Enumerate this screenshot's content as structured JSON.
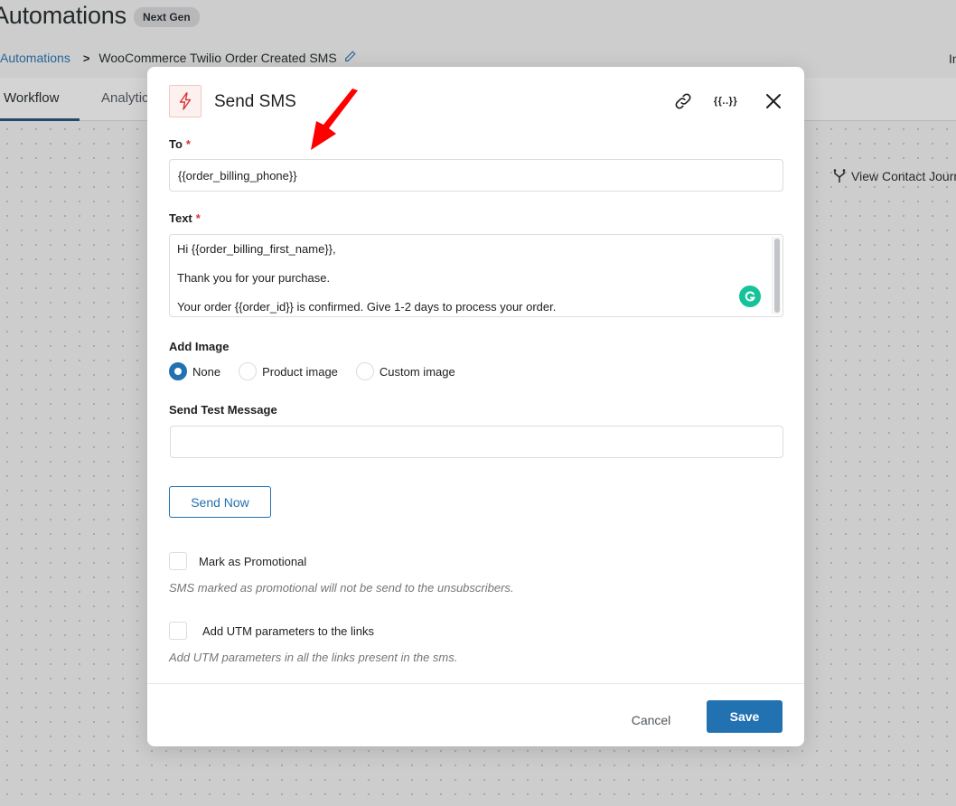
{
  "page": {
    "title": "Automations",
    "badge": "Next Gen",
    "breadcrumb": {
      "parent": "Automations",
      "separator": ">",
      "current": "WooCommerce Twilio Order Created SMS"
    },
    "top_right_text": "In",
    "tabs": [
      {
        "label": "Workflow",
        "active": true
      },
      {
        "label": "Analytics",
        "active": false
      }
    ],
    "view_journey_label": "View Contact Journey"
  },
  "modal": {
    "title": "Send SMS",
    "icons": {
      "action": "lightning-icon",
      "link": "link-icon",
      "merge_tags": "{{..}}",
      "close": "close-icon"
    },
    "to": {
      "label": "To",
      "required_marker": "*",
      "value": "{{order_billing_phone}}"
    },
    "text": {
      "label": "Text",
      "required_marker": "*",
      "lines": [
        "Hi {{order_billing_first_name}},",
        "Thank you for your purchase.",
        "Your order {{order_id}} is confirmed. Give 1-2 days to process your order."
      ]
    },
    "add_image": {
      "label": "Add Image",
      "options": [
        {
          "label": "None",
          "checked": true
        },
        {
          "label": "Product image",
          "checked": false
        },
        {
          "label": "Custom image",
          "checked": false
        }
      ]
    },
    "send_test": {
      "label": "Send Test Message",
      "value": "",
      "button": "Send Now"
    },
    "promotional": {
      "label": "Mark as Promotional",
      "checked": false,
      "help": "SMS marked as promotional will not be send to the unsubscribers."
    },
    "utm": {
      "label": "Add UTM parameters to the links",
      "checked": false,
      "help": "Add UTM parameters in all the links present in the sms."
    },
    "footer": {
      "cancel": "Cancel",
      "save": "Save"
    }
  },
  "colors": {
    "primary": "#2271b1",
    "required": "#d63638",
    "annotation_arrow": "#ff0000",
    "grammarly": "#15c39a"
  }
}
